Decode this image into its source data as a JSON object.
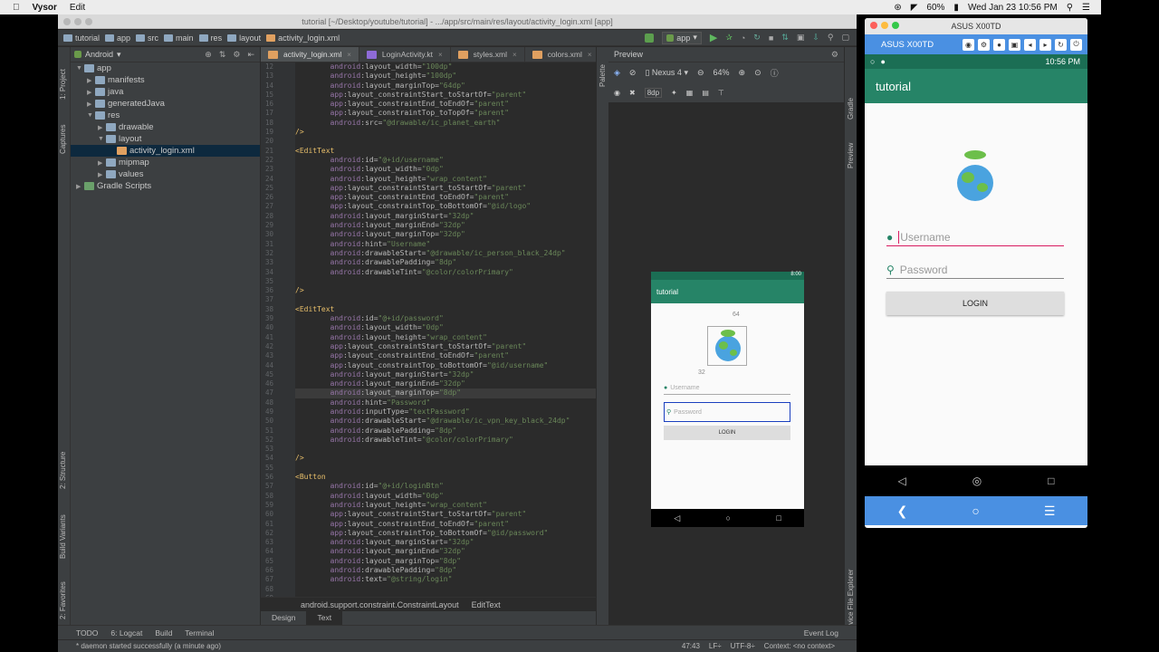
{
  "mac": {
    "app_name": "Vysor",
    "menu_edit": "Edit",
    "battery": "60%",
    "datetime": "Wed Jan 23  10:56 PM"
  },
  "ide": {
    "title": "tutorial [~/Desktop/youtube/tutorial] - .../app/src/main/res/layout/activity_login.xml [app]",
    "breadcrumbs": [
      "tutorial",
      "app",
      "src",
      "main",
      "res",
      "layout",
      "activity_login.xml"
    ],
    "run_config": "app",
    "project_view": "Android",
    "side_left_tabs": [
      "1: Project",
      "Captures",
      "2: Structure",
      "Build Variants",
      "2: Favorites"
    ],
    "side_right_tabs": [
      "Gradle",
      "Preview",
      "Device File Explorer"
    ],
    "palette_label": "Palette",
    "tree": [
      {
        "label": "app",
        "depth": 0,
        "arrow": "▼",
        "color": "#8fa8c0"
      },
      {
        "label": "manifests",
        "depth": 1,
        "arrow": "▶",
        "color": "#8fa8c0"
      },
      {
        "label": "java",
        "depth": 1,
        "arrow": "▶",
        "color": "#8fa8c0"
      },
      {
        "label": "generatedJava",
        "depth": 1,
        "arrow": "▶",
        "color": "#8fa8c0"
      },
      {
        "label": "res",
        "depth": 1,
        "arrow": "▼",
        "color": "#8fa8c0"
      },
      {
        "label": "drawable",
        "depth": 2,
        "arrow": "▶",
        "color": "#8fa8c0"
      },
      {
        "label": "layout",
        "depth": 2,
        "arrow": "▼",
        "color": "#8fa8c0"
      },
      {
        "label": "activity_login.xml",
        "depth": 3,
        "arrow": "",
        "color": "#e0a060",
        "selected": true
      },
      {
        "label": "mipmap",
        "depth": 2,
        "arrow": "▶",
        "color": "#8fa8c0"
      },
      {
        "label": "values",
        "depth": 2,
        "arrow": "▶",
        "color": "#8fa8c0"
      },
      {
        "label": "Gradle Scripts",
        "depth": 0,
        "arrow": "▶",
        "color": "#6aa06a"
      }
    ],
    "tabs": [
      "activity_login.xml",
      "LoginActivity.kt",
      "styles.xml",
      "colors.xml"
    ],
    "code_start_line": 12,
    "code": [
      [
        [
          "i",
          "        "
        ],
        [
          "n",
          "android"
        ],
        [
          "a",
          ":layout_width="
        ],
        [
          "v",
          "\"100dp\""
        ]
      ],
      [
        [
          "i",
          "        "
        ],
        [
          "n",
          "android"
        ],
        [
          "a",
          ":layout_height="
        ],
        [
          "v",
          "\"100dp\""
        ]
      ],
      [
        [
          "i",
          "        "
        ],
        [
          "n",
          "android"
        ],
        [
          "a",
          ":layout_marginTop="
        ],
        [
          "v",
          "\"64dp\""
        ]
      ],
      [
        [
          "i",
          "        "
        ],
        [
          "n",
          "app"
        ],
        [
          "a",
          ":layout_constraintStart_toStartOf="
        ],
        [
          "v",
          "\"parent\""
        ]
      ],
      [
        [
          "i",
          "        "
        ],
        [
          "n",
          "app"
        ],
        [
          "a",
          ":layout_constraintEnd_toEndOf="
        ],
        [
          "v",
          "\"parent\""
        ]
      ],
      [
        [
          "i",
          "        "
        ],
        [
          "n",
          "app"
        ],
        [
          "a",
          ":layout_constraintTop_toTopOf="
        ],
        [
          "v",
          "\"parent\""
        ]
      ],
      [
        [
          "i",
          "        "
        ],
        [
          "n",
          "android"
        ],
        [
          "a",
          ":src="
        ],
        [
          "v",
          "\"@drawable/ic_planet_earth\""
        ]
      ],
      [
        [
          "t",
          "/>"
        ]
      ],
      [],
      [
        [
          "t",
          "<EditText"
        ]
      ],
      [
        [
          "i",
          "        "
        ],
        [
          "n",
          "android"
        ],
        [
          "a",
          ":id="
        ],
        [
          "v",
          "\"@+id/username\""
        ]
      ],
      [
        [
          "i",
          "        "
        ],
        [
          "n",
          "android"
        ],
        [
          "a",
          ":layout_width="
        ],
        [
          "v",
          "\"0dp\""
        ]
      ],
      [
        [
          "i",
          "        "
        ],
        [
          "n",
          "android"
        ],
        [
          "a",
          ":layout_height="
        ],
        [
          "v",
          "\"wrap_content\""
        ]
      ],
      [
        [
          "i",
          "        "
        ],
        [
          "n",
          "app"
        ],
        [
          "a",
          ":layout_constraintStart_toStartOf="
        ],
        [
          "v",
          "\"parent\""
        ]
      ],
      [
        [
          "i",
          "        "
        ],
        [
          "n",
          "app"
        ],
        [
          "a",
          ":layout_constraintEnd_toEndOf="
        ],
        [
          "v",
          "\"parent\""
        ]
      ],
      [
        [
          "i",
          "        "
        ],
        [
          "n",
          "app"
        ],
        [
          "a",
          ":layout_constraintTop_toBottomOf="
        ],
        [
          "v",
          "\"@id/logo\""
        ]
      ],
      [
        [
          "i",
          "        "
        ],
        [
          "n",
          "android"
        ],
        [
          "a",
          ":layout_marginStart="
        ],
        [
          "v",
          "\"32dp\""
        ]
      ],
      [
        [
          "i",
          "        "
        ],
        [
          "n",
          "android"
        ],
        [
          "a",
          ":layout_marginEnd="
        ],
        [
          "v",
          "\"32dp\""
        ]
      ],
      [
        [
          "i",
          "        "
        ],
        [
          "n",
          "android"
        ],
        [
          "a",
          ":layout_marginTop="
        ],
        [
          "v",
          "\"32dp\""
        ]
      ],
      [
        [
          "i",
          "        "
        ],
        [
          "n",
          "android"
        ],
        [
          "a",
          ":hint="
        ],
        [
          "v",
          "\"Username\""
        ]
      ],
      [
        [
          "i",
          "        "
        ],
        [
          "n",
          "android"
        ],
        [
          "a",
          ":drawableStart="
        ],
        [
          "v",
          "\"@drawable/ic_person_black_24dp\""
        ]
      ],
      [
        [
          "i",
          "        "
        ],
        [
          "n",
          "android"
        ],
        [
          "a",
          ":drawablePadding="
        ],
        [
          "v",
          "\"8dp\""
        ]
      ],
      [
        [
          "i",
          "        "
        ],
        [
          "n",
          "android"
        ],
        [
          "a",
          ":drawableTint="
        ],
        [
          "v",
          "\"@color/colorPrimary\""
        ]
      ],
      [],
      [
        [
          "t",
          "/>"
        ]
      ],
      [],
      [
        [
          "t",
          "<EditText"
        ]
      ],
      [
        [
          "i",
          "        "
        ],
        [
          "n",
          "android"
        ],
        [
          "a",
          ":id="
        ],
        [
          "v",
          "\"@+id/password\""
        ]
      ],
      [
        [
          "i",
          "        "
        ],
        [
          "n",
          "android"
        ],
        [
          "a",
          ":layout_width="
        ],
        [
          "v",
          "\"0dp\""
        ]
      ],
      [
        [
          "i",
          "        "
        ],
        [
          "n",
          "android"
        ],
        [
          "a",
          ":layout_height="
        ],
        [
          "v",
          "\"wrap_content\""
        ]
      ],
      [
        [
          "i",
          "        "
        ],
        [
          "n",
          "app"
        ],
        [
          "a",
          ":layout_constraintStart_toStartOf="
        ],
        [
          "v",
          "\"parent\""
        ]
      ],
      [
        [
          "i",
          "        "
        ],
        [
          "n",
          "app"
        ],
        [
          "a",
          ":layout_constraintEnd_toEndOf="
        ],
        [
          "v",
          "\"parent\""
        ]
      ],
      [
        [
          "i",
          "        "
        ],
        [
          "n",
          "app"
        ],
        [
          "a",
          ":layout_constraintTop_toBottomOf="
        ],
        [
          "v",
          "\"@id/username\""
        ]
      ],
      [
        [
          "i",
          "        "
        ],
        [
          "n",
          "android"
        ],
        [
          "a",
          ":layout_marginStart="
        ],
        [
          "v",
          "\"32dp\""
        ]
      ],
      [
        [
          "i",
          "        "
        ],
        [
          "n",
          "android"
        ],
        [
          "a",
          ":layout_marginEnd="
        ],
        [
          "v",
          "\"32dp\""
        ]
      ],
      [
        [
          "i",
          "        "
        ],
        [
          "n",
          "android"
        ],
        [
          "a",
          ":layout_marginTop="
        ],
        [
          "v",
          "\"8dp\""
        ]
      ],
      [
        [
          "i",
          "        "
        ],
        [
          "n",
          "android"
        ],
        [
          "a",
          ":hint="
        ],
        [
          "v",
          "\"Password\""
        ]
      ],
      [
        [
          "i",
          "        "
        ],
        [
          "n",
          "android"
        ],
        [
          "a",
          ":inputType="
        ],
        [
          "v",
          "\"textPassword\""
        ]
      ],
      [
        [
          "i",
          "        "
        ],
        [
          "n",
          "android"
        ],
        [
          "a",
          ":drawableStart="
        ],
        [
          "v",
          "\"@drawable/ic_vpn_key_black_24dp\""
        ]
      ],
      [
        [
          "i",
          "        "
        ],
        [
          "n",
          "android"
        ],
        [
          "a",
          ":drawablePadding="
        ],
        [
          "v",
          "\"8dp\""
        ]
      ],
      [
        [
          "i",
          "        "
        ],
        [
          "n",
          "android"
        ],
        [
          "a",
          ":drawableTint="
        ],
        [
          "v",
          "\"@color/colorPrimary\""
        ]
      ],
      [],
      [
        [
          "t",
          "/>"
        ]
      ],
      [],
      [
        [
          "t",
          "<Button"
        ]
      ],
      [
        [
          "i",
          "        "
        ],
        [
          "n",
          "android"
        ],
        [
          "a",
          ":id="
        ],
        [
          "v",
          "\"@+id/loginBtn\""
        ]
      ],
      [
        [
          "i",
          "        "
        ],
        [
          "n",
          "android"
        ],
        [
          "a",
          ":layout_width="
        ],
        [
          "v",
          "\"0dp\""
        ]
      ],
      [
        [
          "i",
          "        "
        ],
        [
          "n",
          "android"
        ],
        [
          "a",
          ":layout_height="
        ],
        [
          "v",
          "\"wrap_content\""
        ]
      ],
      [
        [
          "i",
          "        "
        ],
        [
          "n",
          "app"
        ],
        [
          "a",
          ":layout_constraintStart_toStartOf="
        ],
        [
          "v",
          "\"parent\""
        ]
      ],
      [
        [
          "i",
          "        "
        ],
        [
          "n",
          "app"
        ],
        [
          "a",
          ":layout_constraintEnd_toEndOf="
        ],
        [
          "v",
          "\"parent\""
        ]
      ],
      [
        [
          "i",
          "        "
        ],
        [
          "n",
          "app"
        ],
        [
          "a",
          ":layout_constraintTop_toBottomOf="
        ],
        [
          "v",
          "\"@id/password\""
        ]
      ],
      [
        [
          "i",
          "        "
        ],
        [
          "n",
          "android"
        ],
        [
          "a",
          ":layout_marginStart="
        ],
        [
          "v",
          "\"32dp\""
        ]
      ],
      [
        [
          "i",
          "        "
        ],
        [
          "n",
          "android"
        ],
        [
          "a",
          ":layout_marginEnd="
        ],
        [
          "v",
          "\"32dp\""
        ]
      ],
      [
        [
          "i",
          "        "
        ],
        [
          "n",
          "android"
        ],
        [
          "a",
          ":layout_marginTop="
        ],
        [
          "v",
          "\"8dp\""
        ]
      ],
      [
        [
          "i",
          "        "
        ],
        [
          "n",
          "android"
        ],
        [
          "a",
          ":drawablePadding="
        ],
        [
          "v",
          "\"8dp\""
        ]
      ],
      [
        [
          "i",
          "        "
        ],
        [
          "n",
          "android"
        ],
        [
          "a",
          ":text="
        ],
        [
          "v",
          "\"@string/login\""
        ]
      ],
      [],
      []
    ],
    "crumb": [
      "android.support.constraint.ConstraintLayout",
      "EditText"
    ],
    "design_tab": "Design",
    "text_tab": "Text",
    "preview_title": "Preview",
    "device": "Nexus 4",
    "zoom": "64%",
    "dp": "8dp",
    "tool_windows": [
      "TODO",
      "6: Logcat",
      "Build",
      "Terminal"
    ],
    "event_log": "Event Log",
    "status_msg": "* daemon started successfully (a minute ago)",
    "status_pos": "47:43",
    "status_lf": "LF÷",
    "status_enc": "UTF-8÷",
    "status_ctx": "Context: <no context>"
  },
  "mock": {
    "app_title": "tutorial",
    "time": "8:00",
    "margin_top": "64",
    "margin_32": "32",
    "username_hint": "Username",
    "password_hint": "Password",
    "login": "LOGIN"
  },
  "vysor": {
    "window_title": "ASUS X00TD",
    "device_name": "ASUS X00TD",
    "time": "10:56 PM",
    "app_title": "tutorial",
    "username_hint": "Username",
    "password_hint": "Password",
    "login": "LOGIN",
    "colors": {
      "primary": "#268467",
      "primary_dark": "#1b6e54",
      "accent": "#d81b60",
      "vysor_blue": "#4a90e2"
    }
  }
}
